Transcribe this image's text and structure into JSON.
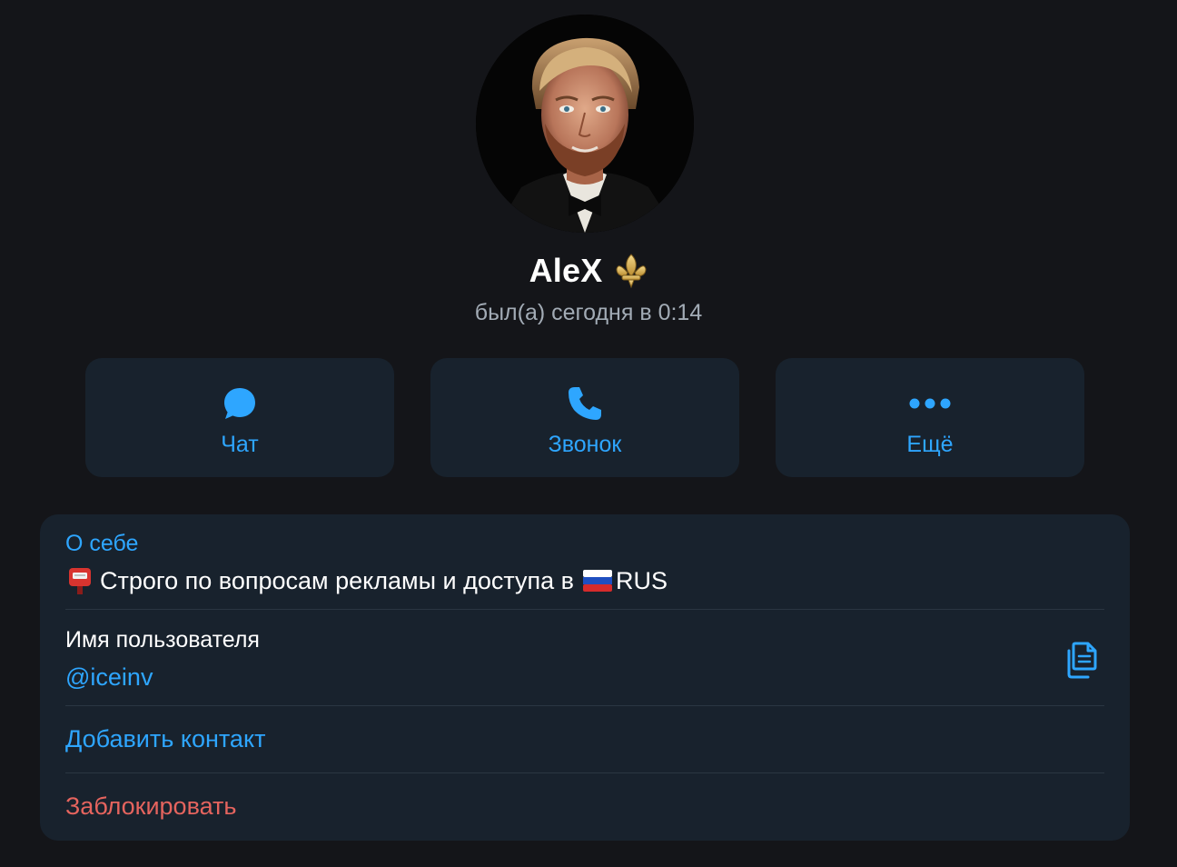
{
  "profile": {
    "name": "AleX",
    "name_emoji": "fleur-de-lis-icon",
    "status": "был(а) сегодня в 0:14"
  },
  "actions": [
    {
      "label": "Чат",
      "icon": "chat-bubble-icon"
    },
    {
      "label": "Звонок",
      "icon": "phone-icon"
    },
    {
      "label": "Ещё",
      "icon": "more-dots-icon"
    }
  ],
  "info": {
    "about_title": "О себе",
    "bio_text": "Строго по вопросам рекламы и доступа в",
    "bio_suffix": "RUS",
    "bio_leading_icon": "postbox-emoji-icon",
    "bio_flag_icon": "russia-flag-icon",
    "username_label": "Имя пользователя",
    "username_value": "@iceinv",
    "add_contact_label": "Добавить контакт",
    "block_label": "Заблокировать"
  },
  "colors": {
    "background": "#141519",
    "card": "#18222d",
    "accent": "#2ea6ff",
    "danger": "#e5645e",
    "secondary_text": "#a2abb5",
    "divider": "#2a3642"
  }
}
